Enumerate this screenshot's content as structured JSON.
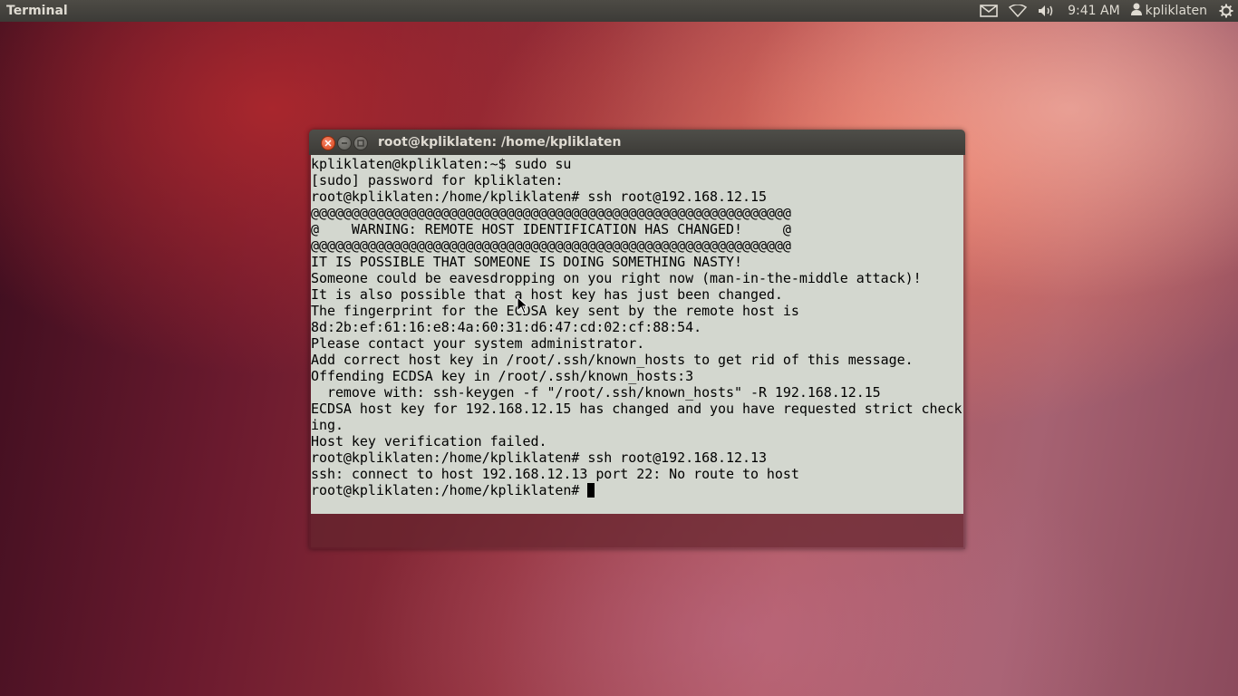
{
  "topbar": {
    "app_name": "Terminal",
    "clock": "9:41 AM",
    "username": "kpliklaten",
    "icons": [
      "mail-icon",
      "wifi-icon",
      "volume-icon",
      "user-icon",
      "gear-icon"
    ]
  },
  "window": {
    "title": "root@kpliklaten: /home/kpliklaten",
    "buttons": [
      "close",
      "minimize",
      "maximize"
    ]
  },
  "terminal": {
    "lines": [
      "kpliklaten@kpliklaten:~$ sudo su",
      "[sudo] password for kpliklaten:",
      "root@kpliklaten:/home/kpliklaten# ssh root@192.168.12.15",
      "@@@@@@@@@@@@@@@@@@@@@@@@@@@@@@@@@@@@@@@@@@@@@@@@@@@@@@@@@@@",
      "@    WARNING: REMOTE HOST IDENTIFICATION HAS CHANGED!     @",
      "@@@@@@@@@@@@@@@@@@@@@@@@@@@@@@@@@@@@@@@@@@@@@@@@@@@@@@@@@@@",
      "IT IS POSSIBLE THAT SOMEONE IS DOING SOMETHING NASTY!",
      "Someone could be eavesdropping on you right now (man-in-the-middle attack)!",
      "It is also possible that a host key has just been changed.",
      "The fingerprint for the ECDSA key sent by the remote host is",
      "8d:2b:ef:61:16:e8:4a:60:31:d6:47:cd:02:cf:88:54.",
      "Please contact your system administrator.",
      "Add correct host key in /root/.ssh/known_hosts to get rid of this message.",
      "Offending ECDSA key in /root/.ssh/known_hosts:3",
      "  remove with: ssh-keygen -f \"/root/.ssh/known_hosts\" -R 192.168.12.15",
      "ECDSA host key for 192.168.12.15 has changed and you have requested strict check",
      "ing.",
      "Host key verification failed.",
      "root@kpliklaten:/home/kpliklaten# ssh root@192.168.12.13",
      "ssh: connect to host 192.168.12.13 port 22: No route to host"
    ],
    "prompt": "root@kpliklaten:/home/kpliklaten# "
  }
}
